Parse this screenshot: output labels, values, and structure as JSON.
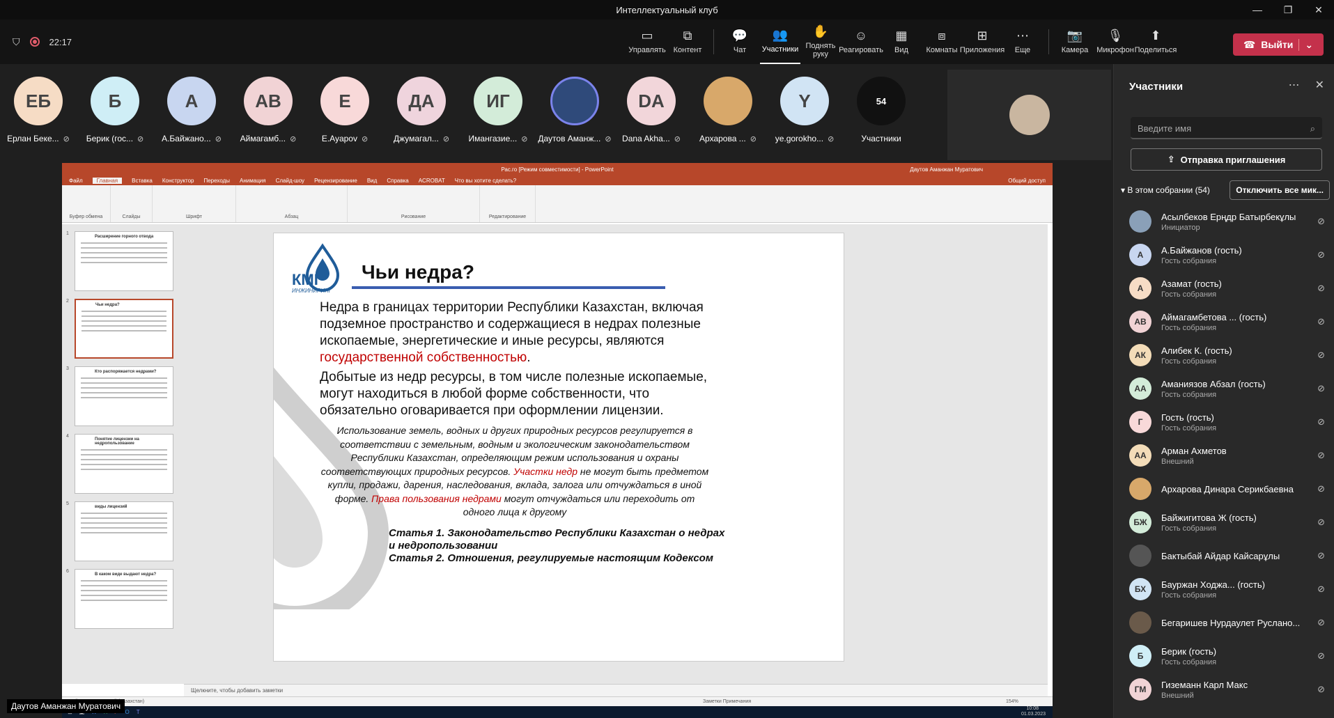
{
  "window": {
    "title": "Интеллектуальный клуб",
    "controls": [
      "—",
      "❐",
      "✕"
    ]
  },
  "toolbar": {
    "time": "22:17",
    "items": [
      {
        "label": "Управлять",
        "icon": "screen-icon",
        "glyph": "▭"
      },
      {
        "label": "Контент",
        "icon": "share-content-icon",
        "glyph": "⧉"
      },
      {
        "label": "Чат",
        "icon": "chat-icon",
        "glyph": "💬"
      },
      {
        "label": "Участники",
        "icon": "people-icon",
        "glyph": "👥"
      },
      {
        "label": "Поднять руку",
        "icon": "raise-hand-icon",
        "glyph": "✋"
      },
      {
        "label": "Реагировать",
        "icon": "react-icon",
        "glyph": "☺"
      },
      {
        "label": "Вид",
        "icon": "view-icon",
        "glyph": "▦"
      },
      {
        "label": "Комнаты",
        "icon": "rooms-icon",
        "glyph": "⧈"
      },
      {
        "label": "Приложения",
        "icon": "apps-icon",
        "glyph": "⊞"
      },
      {
        "label": "Еще",
        "icon": "more-icon",
        "glyph": "⋯"
      },
      {
        "label": "Камера",
        "icon": "camera-off-icon",
        "glyph": "📷"
      },
      {
        "label": "Микрофон",
        "icon": "mic-off-icon",
        "glyph": "🎙"
      },
      {
        "label": "Поделиться",
        "icon": "share-icon",
        "glyph": "⬆"
      }
    ],
    "leave": "Выйти"
  },
  "avatars": [
    {
      "initials": "ЕБ",
      "name": "Ерлан Беке...",
      "color": "#f6dcc5"
    },
    {
      "initials": "Б",
      "name": "Берик (гос...",
      "color": "#cfeef6"
    },
    {
      "initials": "А",
      "name": "А.Байжано...",
      "color": "#c8d6f0"
    },
    {
      "initials": "АВ",
      "name": "Аймагамб...",
      "color": "#f1d3d5"
    },
    {
      "initials": "Е",
      "name": "E.Ayapov",
      "color": "#f8d9d9"
    },
    {
      "initials": "ДА",
      "name": "Джумагал...",
      "color": "#efd4dd"
    },
    {
      "initials": "ИГ",
      "name": "Имангазие...",
      "color": "#d3ecd9"
    },
    {
      "initials": "",
      "name": "Даутов Аманж...",
      "color": "#2f4a7a"
    },
    {
      "initials": "DA",
      "name": "Dana Akha...",
      "color": "#f2d6da"
    },
    {
      "initials": "",
      "name": "Архарова ...",
      "color": "#d8a86a"
    },
    {
      "initials": "Y",
      "name": "ye.gorokho...",
      "color": "#d1e4f4"
    },
    {
      "initials": "54",
      "name": "Участники",
      "color": "#111111"
    }
  ],
  "ppt": {
    "title": "Рас.го [Режим совместимости] - PowerPoint",
    "user": "Даутов Аманжан Муратович",
    "menu": [
      "Файл",
      "Главная",
      "Вставка",
      "Конструктор",
      "Переходы",
      "Анимация",
      "Слайд-шоу",
      "Рецензирование",
      "Вид",
      "Справка",
      "ACROBAT",
      "Что вы хотите сделать?"
    ],
    "share": "Общий доступ",
    "groups": [
      "Буфер обмена",
      "Слайды",
      "Шрифт",
      "Абзац",
      "Рисование",
      "Редактирование"
    ],
    "thumbs": [
      {
        "num": "1",
        "title": "Расширение горного отвода"
      },
      {
        "num": "2",
        "title": "Чьи недра?"
      },
      {
        "num": "3",
        "title": "Кто распоряжается недрами?"
      },
      {
        "num": "4",
        "title": "Понятие лицензии на недропользование"
      },
      {
        "num": "5",
        "title": "виды лицензий"
      },
      {
        "num": "6",
        "title": "В каком виде выдают недра?"
      }
    ],
    "notes": "Щелкните, чтобы добавить заметки",
    "status": "Слайд 2 из 17    русский (Казахстан)",
    "status_right": "Заметки   Примечания",
    "zoom": "154%",
    "clock": "10:08",
    "date": "01.03.2023"
  },
  "slide": {
    "logo": "КМГ",
    "logo_sub": "ИНЖИНИРИНГ",
    "heading": "Чьи недра?",
    "p1": "Недра в границах территории Республики Казахстан, включая подземное пространство и содержащиеся в недрах  полезные ископаемые, энергетические и иные ресурсы, являются",
    "p1_red": "государственной собственностью",
    "p1_end": ".",
    "p2": "Добытые  из недр ресурсы, в том числе полезные ископаемые, могут находиться в любой форме собственности, что обязательно оговаривается при оформлении лицензии.",
    "i1": "Использование земель, водных и других природных ресурсов регулируется в соответствии с земельным, водным и экологическим законодательством Республики Казахстан, определяющим режим использования и охраны соответствующих природных ресурсов.",
    "i_red1": "Участки недр",
    "i2": "не могут быть предметом купли, продажи, дарения, наследования, вклада, залога или отчуждаться в иной форме.",
    "i_red2": "Права пользования недрами",
    "i3": "могут отчуждаться или переходить от одного лица к другому",
    "art1": "Статья 1. Законодательство Республики Казахстан о недрах и недропользовании",
    "art2": "Статья 2. Отношения, регулируемые настоящим Кодексом"
  },
  "nametag": "Даутов Аманжан Муратович",
  "panel": {
    "title": "Участники",
    "search_placeholder": "Введите имя",
    "invite": "Отправка приглашения",
    "section": "В этом собрании (54)",
    "mute_all": "Отключить все мик...",
    "people": [
      {
        "initials": "",
        "name": "Асылбеков Ерңдр Батырбекұлы",
        "sub": "Инициатор",
        "color": "#8aa0b8"
      },
      {
        "initials": "А",
        "name": "А.Байжанов (гость)",
        "sub": "Гость собрания",
        "color": "#c8d6f0"
      },
      {
        "initials": "А",
        "name": "Азамат (гость)",
        "sub": "Гость собрания",
        "color": "#f6dcc5"
      },
      {
        "initials": "АВ",
        "name": "Аймагамбетова ... (гость)",
        "sub": "Гость собрания",
        "color": "#f1d3d5"
      },
      {
        "initials": "АК",
        "name": "Алибек К. (гость)",
        "sub": "Гость собрания",
        "color": "#f3dcb8"
      },
      {
        "initials": "АА",
        "name": "Аманиязов Абзал (гость)",
        "sub": "Гость собрания",
        "color": "#d3ecd9"
      },
      {
        "initials": "Г",
        "name": "Гость (гость)",
        "sub": "Гость собрания",
        "color": "#f8d9d9"
      },
      {
        "initials": "АА",
        "name": "Арман Ахметов",
        "sub": "Внешний",
        "color": "#f3dcb8"
      },
      {
        "initials": "",
        "name": "Архарова Динара Серикбаевна",
        "sub": "",
        "color": "#d8a86a"
      },
      {
        "initials": "БЖ",
        "name": "Байжигитова Ж (гость)",
        "sub": "Гость собрания",
        "color": "#d3ecd9"
      },
      {
        "initials": "",
        "name": "Бактыбай Айдар Кайсарұлы",
        "sub": "",
        "color": "#555"
      },
      {
        "initials": "БХ",
        "name": "Бауржан Ходжа... (гость)",
        "sub": "Гость собрания",
        "color": "#d1e4f4"
      },
      {
        "initials": "",
        "name": "Бегаришев Нурдаулет Руслано...",
        "sub": "",
        "color": "#6a5a4a"
      },
      {
        "initials": "Б",
        "name": "Берик (гость)",
        "sub": "Гость собрания",
        "color": "#cfeef6"
      },
      {
        "initials": "ГМ",
        "name": "Гиземанн Карл Макс",
        "sub": "Внешний",
        "color": "#f1d3d5"
      }
    ]
  }
}
